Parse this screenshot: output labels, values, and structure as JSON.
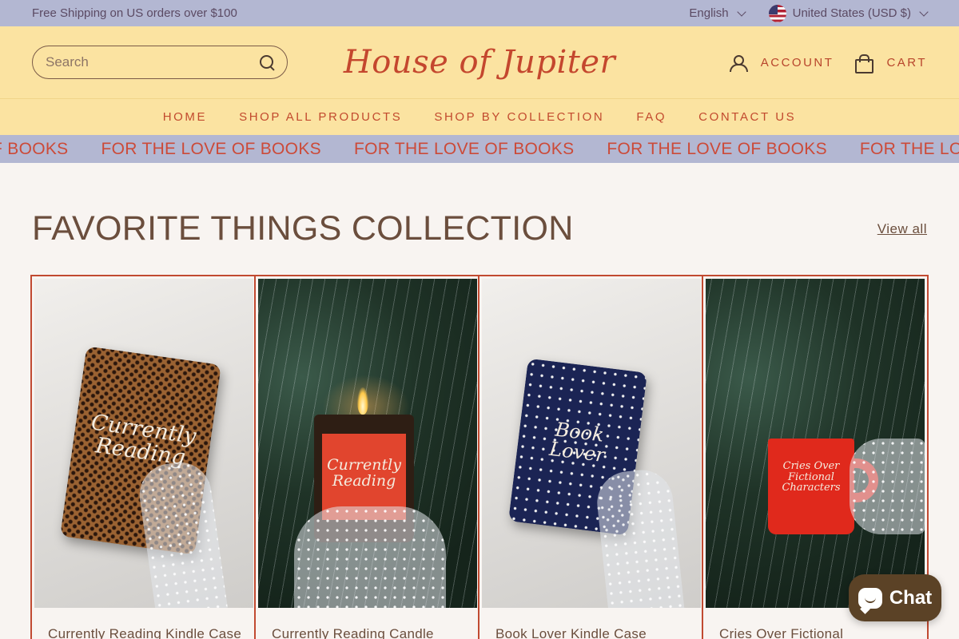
{
  "announcement": {
    "text": "Free Shipping on US orders over $100",
    "language": "English",
    "currency": "United States (USD $)"
  },
  "header": {
    "search_placeholder": "Search",
    "logo_text": "House of Jupiter",
    "account_label": "ACCOUNT",
    "cart_label": "CART"
  },
  "nav": {
    "items": [
      "HOME",
      "SHOP ALL PRODUCTS",
      "SHOP BY COLLECTION",
      "FAQ",
      "CONTACT US"
    ]
  },
  "marquee": {
    "items": [
      "FOR THE LOVE OF BOOKS",
      "FOR THE LOVE OF BOOKS",
      "FOR THE LOVE OF BOOKS",
      "FOR THE LOVE OF BOOKS",
      "FOR THE LOVE OF BOOKS"
    ]
  },
  "collection": {
    "title": "FAVORITE THINGS COLLECTION",
    "view_all": "View all",
    "products": [
      {
        "name": "Currently Reading Kindle Case",
        "image_text": "Currently Reading"
      },
      {
        "name": "Currently Reading Candle",
        "image_text": "Currently Reading"
      },
      {
        "name": "Book Lover Kindle Case",
        "image_text": "Book Lover"
      },
      {
        "name": "Cries Over Fictional",
        "image_text": "Cries Over Fictional Characters"
      }
    ]
  },
  "chat": {
    "label": "Chat"
  },
  "colors": {
    "announcement_bg": "#b3b7d2",
    "header_bg": "#fbe3a1",
    "accent": "#c14a31",
    "page_bg": "#f8f4f1",
    "chat_bg": "#5b4226"
  }
}
